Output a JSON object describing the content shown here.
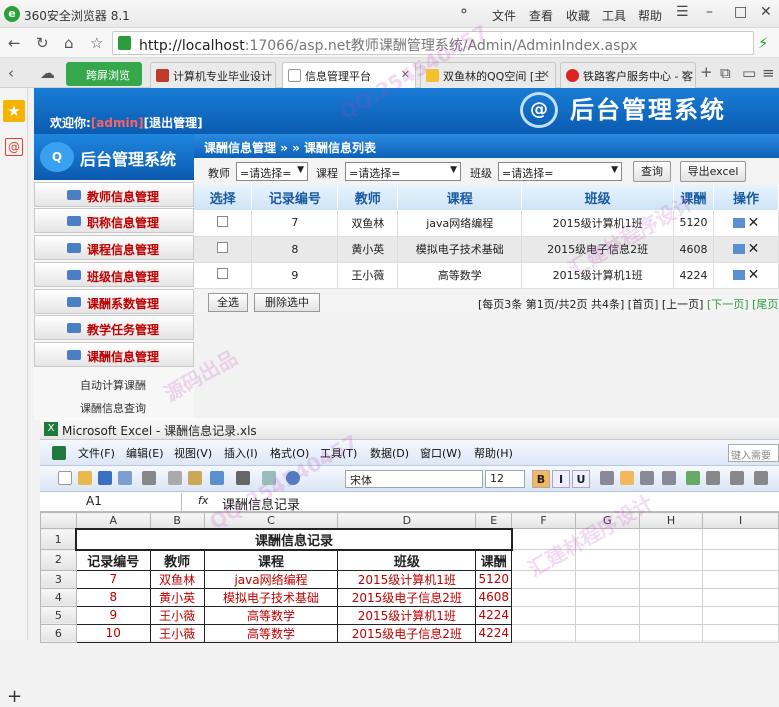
{
  "browser": {
    "app_title": "360安全浏览器 8.1",
    "menu": [
      "文件",
      "查看",
      "收藏",
      "工具",
      "帮助"
    ],
    "url_host": "http://localhost",
    "url_rest": ":17066/asp.net教师课酬管理系统/Admin/AdminIndex.aspx",
    "ie_tab_label": "跨屏浏览",
    "tabs": [
      {
        "label": "计算机专业毕业设计"
      },
      {
        "label": "信息管理平台"
      },
      {
        "label": "双鱼林的QQ空间 [主"
      },
      {
        "label": "铁路客户服务中心 - 客"
      }
    ]
  },
  "admin": {
    "welcome_prefix": "欢迎你:",
    "username": "[admin]",
    "logout": "[退出管理]",
    "system_title": "后台管理系统",
    "logo_glyph": "@",
    "menu": [
      "教师信息管理",
      "职称信息管理",
      "课程信息管理",
      "班级信息管理",
      "课酬系数管理",
      "教学任务管理",
      "课酬信息管理"
    ],
    "submenu": [
      "自动计算课酬",
      "课酬信息查询"
    ],
    "breadcrumb": "课酬信息管理 » » 课酬信息列表",
    "filter": {
      "teacher_label": "教师",
      "teacher_value": "=请选择=",
      "course_label": "课程",
      "course_value": "=请选择=",
      "class_label": "班级",
      "class_value": "=请选择=",
      "query_btn": "查询",
      "export_btn": "导出excel"
    },
    "table": {
      "headers": [
        "选择",
        "记录编号",
        "教师",
        "课程",
        "班级",
        "课酬",
        "操作"
      ],
      "rows": [
        {
          "id": "7",
          "teacher": "双鱼林",
          "course": "java网络编程",
          "class": "2015级计算机1班",
          "pay": "5120"
        },
        {
          "id": "8",
          "teacher": "黄小英",
          "course": "模拟电子技术基础",
          "class": "2015级电子信息2班",
          "pay": "4608"
        },
        {
          "id": "9",
          "teacher": "王小薇",
          "course": "高等数学",
          "class": "2015级计算机1班",
          "pay": "4224"
        }
      ]
    },
    "select_all_btn": "全选",
    "delete_btn": "删除选中",
    "pager": {
      "info": "[每页3条 第1页/共2页 共4条]",
      "first": "[首页]",
      "prev": "[上一页]",
      "next": "[下一页]",
      "last": "[尾页]"
    }
  },
  "excel": {
    "title": "Microsoft Excel - 课酬信息记录.xls",
    "menu": [
      "文件(F)",
      "编辑(E)",
      "视图(V)",
      "插入(I)",
      "格式(O)",
      "工具(T)",
      "数据(D)",
      "窗口(W)",
      "帮助(H)"
    ],
    "help_placeholder": "键入需要",
    "font": "宋体",
    "size": "12",
    "format_buttons": [
      "B",
      "I",
      "U"
    ],
    "cell_ref": "A1",
    "fx": "fx",
    "formula": "课酬信息记录",
    "columns": [
      "A",
      "B",
      "C",
      "D",
      "E",
      "F",
      "G",
      "H",
      "I"
    ],
    "sheet_title": "课酬信息记录",
    "headers": [
      "记录编号",
      "教师",
      "课程",
      "班级",
      "课酬"
    ],
    "rows": [
      [
        "7",
        "双鱼林",
        "java网络编程",
        "2015级计算机1班",
        "5120"
      ],
      [
        "8",
        "黄小英",
        "模拟电子技术基础",
        "2015级电子信息2班",
        "4608"
      ],
      [
        "9",
        "王小薇",
        "高等数学",
        "2015级计算机1班",
        "4224"
      ],
      [
        "10",
        "王小薇",
        "高等数学",
        "2015级电子信息2班",
        "4224"
      ]
    ]
  },
  "watermarks": [
    "QQ:254540457",
    "汇建林程序设计",
    "源码出品"
  ]
}
